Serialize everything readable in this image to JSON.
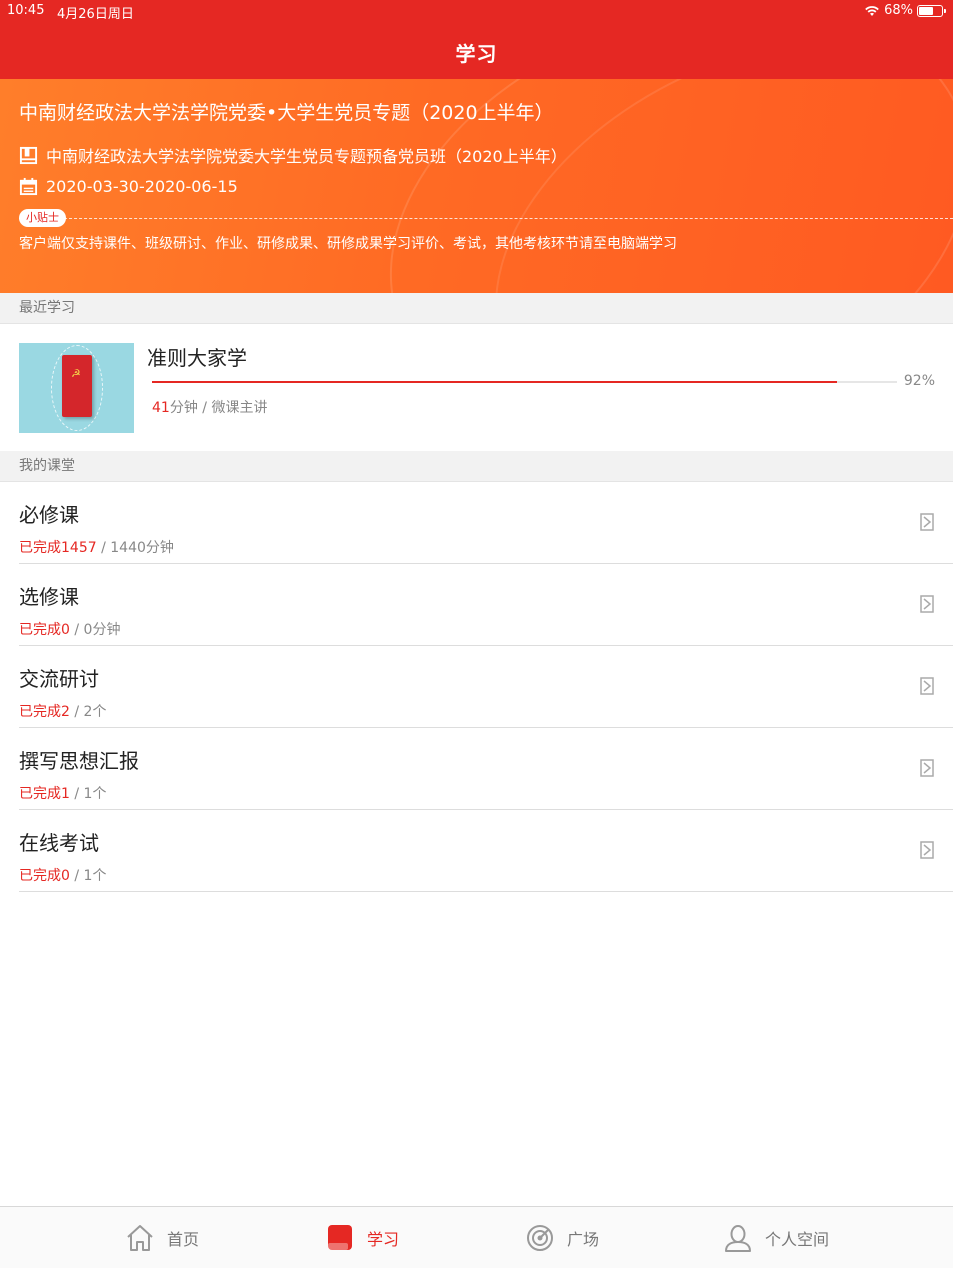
{
  "status_bar": {
    "time": "10:45",
    "date": "4月26日周日",
    "battery": "68%",
    "battery_level": 0.68
  },
  "nav": {
    "title": "学习"
  },
  "banner": {
    "title": "中南财经政法大学法学院党委•大学生党员专题（2020上半年）",
    "class_name": "中南财经政法大学法学院党委大学生党员专题预备党员班（2020上半年）",
    "date_range": "2020-03-30-2020-06-15",
    "tip_badge": "小贴士",
    "tip_text": "客户端仅支持课件、班级研讨、作业、研修成果、研修成果学习评价、考试，其他考核环节请至电脑端学习"
  },
  "recent_section": {
    "header": "最近学习"
  },
  "recent": {
    "name": "准则大家学",
    "progress_percent": 92,
    "progress_label": "92%",
    "minutes": "41",
    "minutes_unit": "分钟",
    "separator": " / ",
    "type": "微课主讲"
  },
  "classroom_section": {
    "header": "我的课堂"
  },
  "courses": [
    {
      "name": "必修课",
      "done_label": "已完成",
      "done": "1457",
      "total": "1440分钟"
    },
    {
      "name": "选修课",
      "done_label": "已完成",
      "done": "0",
      "total": "0分钟"
    },
    {
      "name": "交流研讨",
      "done_label": "已完成",
      "done": "2",
      "total": "2个"
    },
    {
      "name": "撰写思想汇报",
      "done_label": "已完成",
      "done": "1",
      "total": "1个"
    },
    {
      "name": "在线考试",
      "done_label": "已完成",
      "done": "0",
      "total": "1个"
    }
  ],
  "tabs": [
    {
      "label": "首页",
      "icon": "home-icon"
    },
    {
      "label": "学习",
      "icon": "book-icon",
      "active": true
    },
    {
      "label": "广场",
      "icon": "radar-icon"
    },
    {
      "label": "个人空间",
      "icon": "user-icon"
    }
  ],
  "colors": {
    "primary": "#e52823",
    "banner": "#ff6a24"
  }
}
